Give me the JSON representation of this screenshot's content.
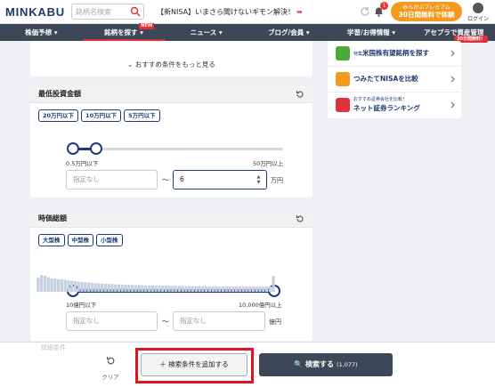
{
  "header": {
    "logo": "MINKABU",
    "search_placeholder": "銘柄名検索",
    "promo_text": "【新NISA】いまさら聞けないギモン解決！",
    "promo_arrow": "➡",
    "notification_count": "1",
    "premium_line1": "みんかぶプレミアム",
    "premium_line2": "30日間無料で体験",
    "login_label": "ログイン"
  },
  "nav": {
    "items": [
      {
        "label": "株価予想 ▾"
      },
      {
        "label": "銘柄を探す ▾",
        "badge": "NEW"
      },
      {
        "label": "ニュース ▾"
      },
      {
        "label": "ブログ/会員 ▾"
      },
      {
        "label": "学習/お得情報 ▾"
      },
      {
        "label": "アセプラで資産管理",
        "badge": "30日間無料！"
      }
    ]
  },
  "more_conditions": "⌄ おすすめ条件をもっと見る",
  "min_invest": {
    "title": "最低投資金額",
    "chips": [
      "20万円以下",
      "10万円以下",
      "5万円以下"
    ],
    "slider_min_label": "0.5万円以下",
    "slider_max_label": "50万円以上",
    "slider_low_fraction": 0.0,
    "slider_high_fraction": 0.13,
    "input_min_placeholder": "指定なし",
    "tilde": "〜",
    "input_max_value": "6",
    "unit": "万円"
  },
  "market_cap": {
    "title": "時価総額",
    "chips": [
      "大型株",
      "中型株",
      "小型株"
    ],
    "histogram": [
      0.52,
      0.63,
      0.6,
      0.55,
      0.5,
      0.5,
      0.47,
      0.47,
      0.45,
      0.43,
      0.42,
      0.4,
      0.38,
      0.37,
      0.36,
      0.35,
      0.34,
      0.33,
      0.32,
      0.31,
      0.3,
      0.3,
      0.29,
      0.28,
      0.28,
      0.27,
      0.27,
      0.26,
      0.26,
      0.25,
      0.25,
      0.25,
      0.24,
      0.24,
      0.24,
      0.23,
      0.23,
      0.23,
      0.23,
      0.22,
      0.22,
      0.22,
      0.22,
      0.22,
      0.21,
      0.21,
      0.21,
      0.21,
      0.21,
      0.21,
      0.2,
      0.2,
      0.2,
      0.2,
      0.2,
      0.2,
      0.2,
      0.2,
      0.2,
      0.2,
      0.2,
      0.2,
      0.2,
      0.2,
      0.2,
      0.2,
      0.2,
      0.2,
      0.2,
      0.2,
      0.6
    ],
    "slider_min_label": "10億円以下",
    "slider_max_label": "10,000億円以上",
    "input_min_placeholder": "指定なし",
    "tilde": "〜",
    "input_max_placeholder": "指定なし",
    "unit": "億円"
  },
  "side": {
    "items": [
      {
        "small": "特集",
        "label": "米国株有望銘柄を探す",
        "icon_color": "#4caa3c"
      },
      {
        "label": "つみたてNISAを比較",
        "icon_color": "#f39a1e"
      },
      {
        "small": "おすすめ証券会社を比較！",
        "label": "ネット証券ランキング",
        "icon_color": "#e0303a"
      }
    ]
  },
  "bottom": {
    "peek_label": "詳細条件",
    "clear_label": "クリア",
    "add_label": "＋ 検索条件を追加する",
    "search_label": "🔍 検索する",
    "search_count": "(1,077)"
  }
}
